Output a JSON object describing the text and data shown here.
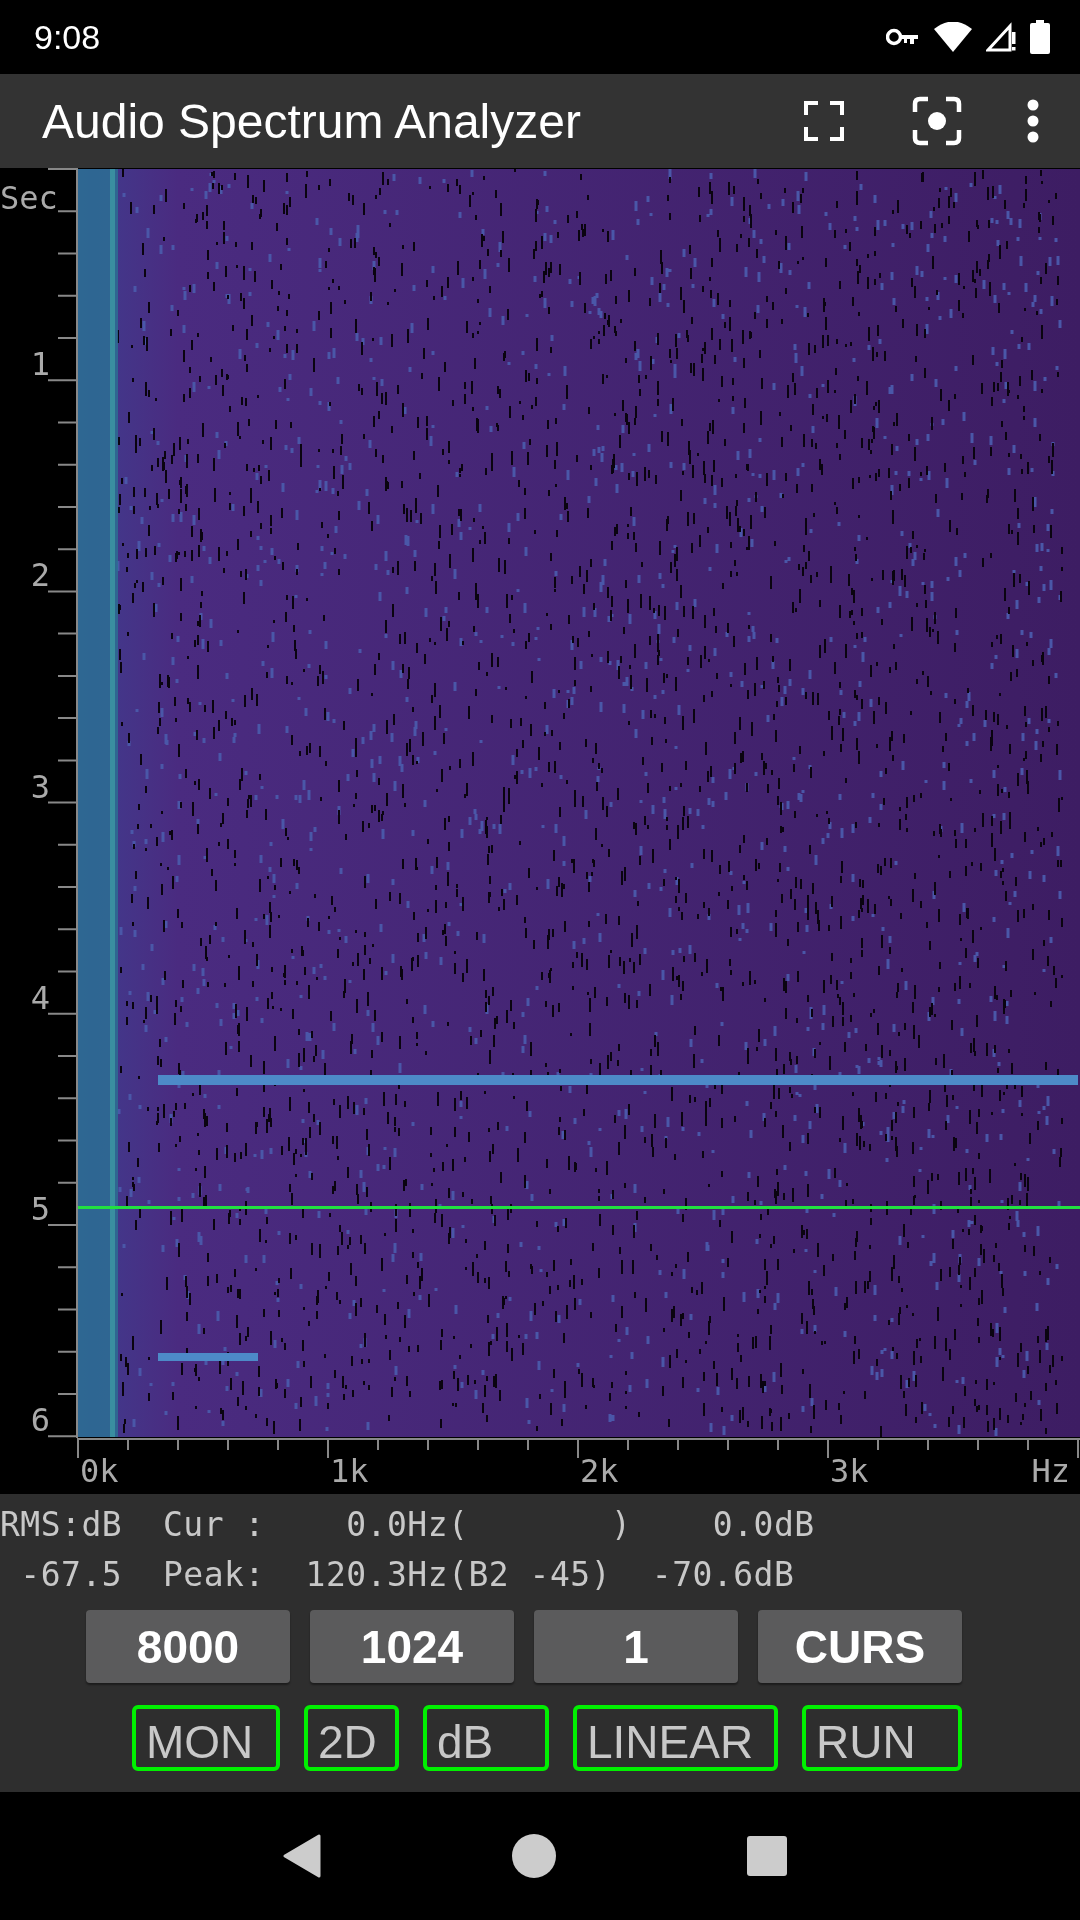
{
  "status_bar": {
    "time": "9:08"
  },
  "app_bar": {
    "title": "Audio Spectrum Analyzer"
  },
  "spectrogram": {
    "y_axis_title": "Sec",
    "y_labels": [
      "1",
      "2",
      "3",
      "4",
      "5",
      "6"
    ],
    "x_labels": [
      "0k",
      "1k",
      "2k",
      "3k"
    ],
    "x_axis_unit": "Hz"
  },
  "readout": {
    "lines": [
      "RMS:dB  Cur :    0.0Hz(       )    0.0dB",
      " -67.5  Peak:  120.3Hz(B2 -45)  -70.6dB"
    ]
  },
  "settings_buttons": [
    "8000",
    "1024",
    "1",
    "CURS"
  ],
  "toggle_buttons": [
    "MON",
    "2D",
    "dB",
    "LINEAR",
    "RUN"
  ]
}
